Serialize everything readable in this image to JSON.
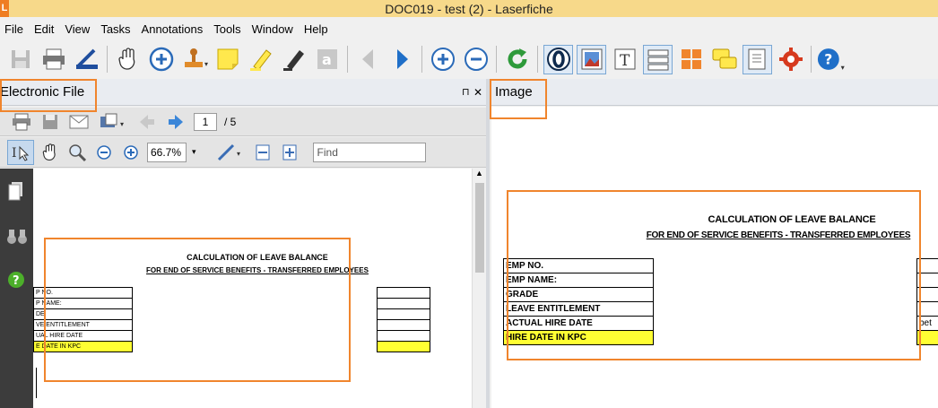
{
  "window": {
    "logo": "L",
    "title": "DOC019 - test (2) - Laserfiche"
  },
  "menu": [
    "File",
    "Edit",
    "View",
    "Tasks",
    "Annotations",
    "Tools",
    "Window",
    "Help"
  ],
  "toolbar_icons": [
    "save-icon",
    "print-icon",
    "scanner-icon",
    "pan-hand-icon",
    "zoom-in-icon",
    "stamp-icon",
    "sticky-note-icon",
    "highlighter-icon",
    "marker-icon",
    "text-annotation-icon",
    "previous-page-icon",
    "next-page-icon",
    "add-page-icon",
    "remove-page-icon",
    "refresh-icon",
    "ocr-icon",
    "image-view-icon",
    "text-view-icon",
    "fields-view-icon",
    "thumbnails-icon",
    "annotations-panel-icon",
    "metadata-icon",
    "settings-icon",
    "help-icon"
  ],
  "left_pane": {
    "title": "Electronic File",
    "pin": "⊓",
    "close": "✕",
    "page_current": "1",
    "page_total": "/ 5",
    "zoom": "66.7%",
    "find_placeholder": "Find"
  },
  "right_pane": {
    "title": "Image"
  },
  "document": {
    "title": "CALCULATION OF LEAVE BALANCE",
    "subtitle": "FOR END OF SERVICE BENEFITS - TRANSFERRED EMPLOYEES",
    "left_rows": [
      "P NO.",
      "P NAME:",
      "DE",
      "VE ENTITLEMENT",
      "UAL HIRE DATE",
      "E DATE IN KPC"
    ],
    "image_title": "CALCULATION OF LEAVE BALANCE",
    "image_subtitle": "FOR END OF SERVICE BENEFITS - TRANSFERRED EMPLOYEES",
    "image_rows": [
      "EMP NO.",
      "EMP NAME:",
      "GRADE",
      "LEAVE ENTITLEMENT",
      "ACTUAL HIRE DATE",
      "HIRE DATE IN KPC"
    ],
    "image_right_fragment": "bet"
  },
  "colors": {
    "titlebar": "#f7d98a",
    "highlight_box": "#f0852d",
    "row_highlight": "#ffff33"
  }
}
